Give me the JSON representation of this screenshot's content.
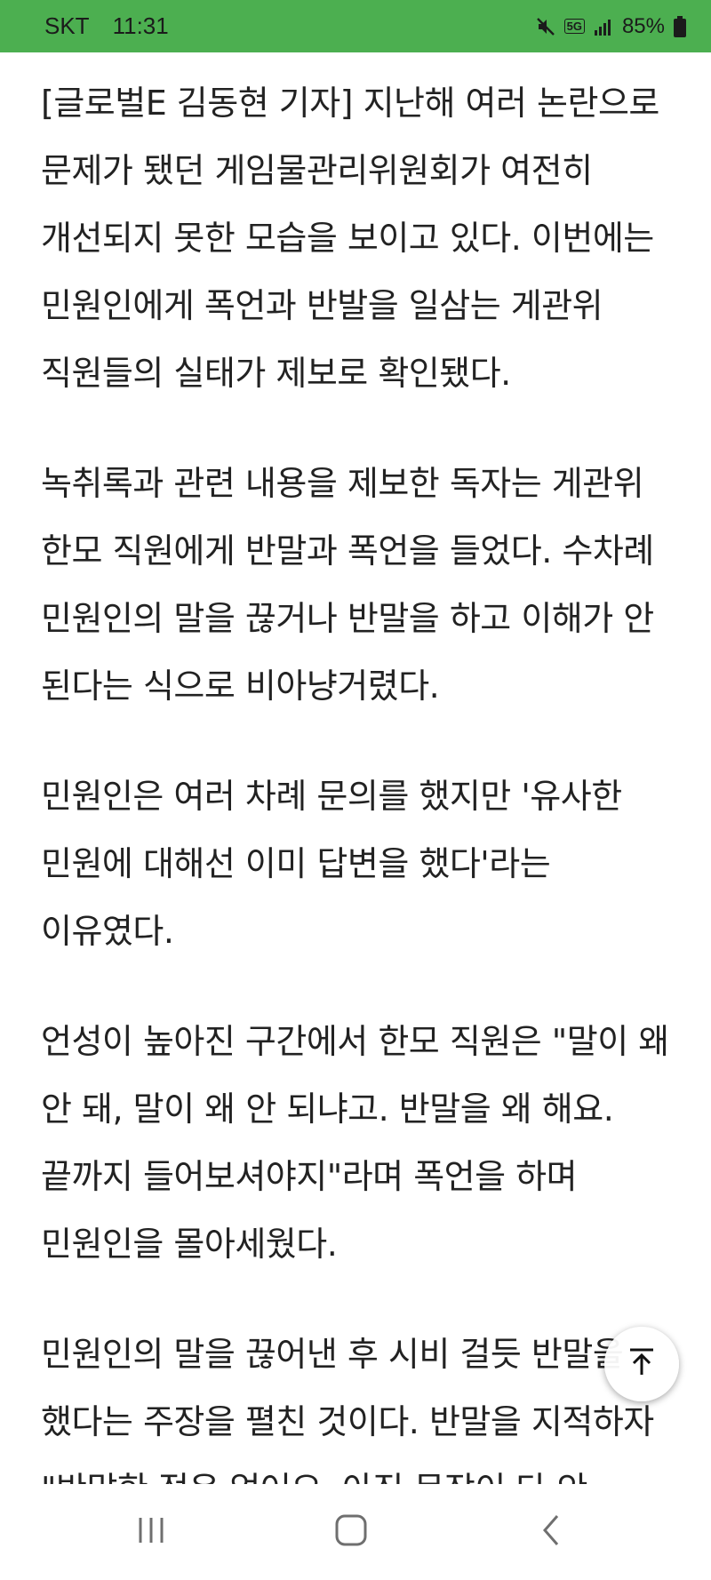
{
  "status_bar": {
    "carrier": "SKT",
    "time": "11:31",
    "network_badge": "5G",
    "battery": "85%",
    "icons": [
      "mute-icon",
      "5g-icon",
      "signal-icon",
      "battery-icon"
    ]
  },
  "article": {
    "paragraphs": [
      "[글로벌E 김동현 기자] 지난해 여러 논란으로 문제가 됐던 게임물관리위원회가 여전히 개선되지 못한 모습을 보이고 있다. 이번에는 민원인에게 폭언과 반발을 일삼는 게관위 직원들의 실태가 제보로 확인됐다.",
      "녹취록과 관련 내용을 제보한 독자는 게관위 한모 직원에게 반말과 폭언을 들었다. 수차례 민원인의 말을 끊거나 반말을 하고 이해가 안 된다는 식으로 비아냥거렸다.",
      "민원인은 여러 차례 문의를 했지만 '유사한 민원에 대해선 이미 답변을 했다'라는 이유였다.",
      "언성이 높아진 구간에서 한모 직원은 \"말이 왜 안 돼, 말이 왜 안 되냐고. 반말을 왜 해요. 끝까지 들어보셔야지\"라며 폭언을 하며 민원인을 몰아세웠다.",
      "민원인의 말을 끊어낸 후 시비 걸듯 반말을 했다는 주장을 펼친 것이다. 반말을 지적하자 \"반말한 적은 없어요. 아직 문장이 다 안 끝났잖아요, 말이\"라고 한 후 \"끝까지 들어야지.\"라고 또"
    ]
  },
  "scroll_top_button": {
    "icon": "arrow-up-to-top-icon"
  },
  "nav_bar": {
    "recent_apps_icon": "recent-apps-icon",
    "home_icon": "home-icon",
    "back_icon": "back-icon"
  },
  "colors": {
    "status_bar": "#4caf50",
    "text": "#222222",
    "background": "#ffffff",
    "nav_icons": "#6f6f6f"
  }
}
